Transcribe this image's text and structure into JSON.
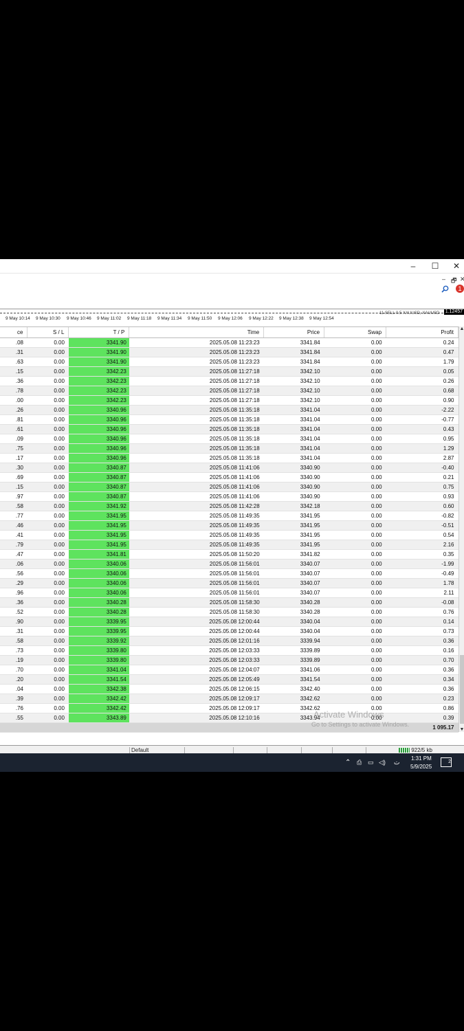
{
  "window": {
    "min_glyph": "–",
    "max_glyph": "☐",
    "close_glyph": "✕"
  },
  "mdi": {
    "min_glyph": "–",
    "restore_glyph": "🗗",
    "close_glyph": "✕"
  },
  "notification_count": "1",
  "chart": {
    "price_tag": "1.12457",
    "truncated_label": "11.SELL 0.5 XAUUSD, XAUUSD",
    "time_labels": [
      "9 May 10:14",
      "9 May 10:30",
      "9 May 10:46",
      "9 May 11:02",
      "9 May 11:18",
      "9 May 11:34",
      "9 May 11:50",
      "9 May 12:06",
      "9 May 12:22",
      "9 May 12:38",
      "9 May 12:54"
    ]
  },
  "table": {
    "columns": [
      "ce",
      "S / L",
      "T / P",
      "Time",
      "Price",
      "Swap",
      "Profit"
    ],
    "rows": [
      [
        ".08",
        "0.00",
        "3341.90",
        "2025.05.08 11:23:23",
        "3341.84",
        "0.00",
        "0.24"
      ],
      [
        ".31",
        "0.00",
        "3341.90",
        "2025.05.08 11:23:23",
        "3341.84",
        "0.00",
        "0.47"
      ],
      [
        ".63",
        "0.00",
        "3341.90",
        "2025.05.08 11:23:23",
        "3341.84",
        "0.00",
        "1.79"
      ],
      [
        ".15",
        "0.00",
        "3342.23",
        "2025.05.08 11:27:18",
        "3342.10",
        "0.00",
        "0.05"
      ],
      [
        ".36",
        "0.00",
        "3342.23",
        "2025.05.08 11:27:18",
        "3342.10",
        "0.00",
        "0.26"
      ],
      [
        ".78",
        "0.00",
        "3342.23",
        "2025.05.08 11:27:18",
        "3342.10",
        "0.00",
        "0.68"
      ],
      [
        ".00",
        "0.00",
        "3342.23",
        "2025.05.08 11:27:18",
        "3342.10",
        "0.00",
        "0.90"
      ],
      [
        ".26",
        "0.00",
        "3340.96",
        "2025.05.08 11:35:18",
        "3341.04",
        "0.00",
        "-2.22"
      ],
      [
        ".81",
        "0.00",
        "3340.96",
        "2025.05.08 11:35:18",
        "3341.04",
        "0.00",
        "-0.77"
      ],
      [
        ".61",
        "0.00",
        "3340.96",
        "2025.05.08 11:35:18",
        "3341.04",
        "0.00",
        "0.43"
      ],
      [
        ".09",
        "0.00",
        "3340.96",
        "2025.05.08 11:35:18",
        "3341.04",
        "0.00",
        "0.95"
      ],
      [
        ".75",
        "0.00",
        "3340.96",
        "2025.05.08 11:35:18",
        "3341.04",
        "0.00",
        "1.29"
      ],
      [
        ".17",
        "0.00",
        "3340.96",
        "2025.05.08 11:35:18",
        "3341.04",
        "0.00",
        "2.87"
      ],
      [
        ".30",
        "0.00",
        "3340.87",
        "2025.05.08 11:41:06",
        "3340.90",
        "0.00",
        "-0.40"
      ],
      [
        ".69",
        "0.00",
        "3340.87",
        "2025.05.08 11:41:06",
        "3340.90",
        "0.00",
        "0.21"
      ],
      [
        ".15",
        "0.00",
        "3340.87",
        "2025.05.08 11:41:06",
        "3340.90",
        "0.00",
        "0.75"
      ],
      [
        ".97",
        "0.00",
        "3340.87",
        "2025.05.08 11:41:06",
        "3340.90",
        "0.00",
        "0.93"
      ],
      [
        ".58",
        "0.00",
        "3341.92",
        "2025.05.08 11:42:28",
        "3342.18",
        "0.00",
        "0.60"
      ],
      [
        ".77",
        "0.00",
        "3341.95",
        "2025.05.08 11:49:35",
        "3341.95",
        "0.00",
        "-0.82"
      ],
      [
        ".46",
        "0.00",
        "3341.95",
        "2025.05.08 11:49:35",
        "3341.95",
        "0.00",
        "-0.51"
      ],
      [
        ".41",
        "0.00",
        "3341.95",
        "2025.05.08 11:49:35",
        "3341.95",
        "0.00",
        "0.54"
      ],
      [
        ".79",
        "0.00",
        "3341.95",
        "2025.05.08 11:49:35",
        "3341.95",
        "0.00",
        "2.16"
      ],
      [
        ".47",
        "0.00",
        "3341.81",
        "2025.05.08 11:50:20",
        "3341.82",
        "0.00",
        "0.35"
      ],
      [
        ".06",
        "0.00",
        "3340.06",
        "2025.05.08 11:56:01",
        "3340.07",
        "0.00",
        "-1.99"
      ],
      [
        ".56",
        "0.00",
        "3340.06",
        "2025.05.08 11:56:01",
        "3340.07",
        "0.00",
        "-0.49"
      ],
      [
        ".29",
        "0.00",
        "3340.06",
        "2025.05.08 11:56:01",
        "3340.07",
        "0.00",
        "1.78"
      ],
      [
        ".96",
        "0.00",
        "3340.06",
        "2025.05.08 11:56:01",
        "3340.07",
        "0.00",
        "2.11"
      ],
      [
        ".36",
        "0.00",
        "3340.28",
        "2025.05.08 11:58:30",
        "3340.28",
        "0.00",
        "-0.08"
      ],
      [
        ".52",
        "0.00",
        "3340.28",
        "2025.05.08 11:58:30",
        "3340.28",
        "0.00",
        "0.76"
      ],
      [
        ".90",
        "0.00",
        "3339.95",
        "2025.05.08 12:00:44",
        "3340.04",
        "0.00",
        "0.14"
      ],
      [
        ".31",
        "0.00",
        "3339.95",
        "2025.05.08 12:00:44",
        "3340.04",
        "0.00",
        "0.73"
      ],
      [
        ".58",
        "0.00",
        "3339.92",
        "2025.05.08 12:01:16",
        "3339.94",
        "0.00",
        "0.36"
      ],
      [
        ".73",
        "0.00",
        "3339.80",
        "2025.05.08 12:03:33",
        "3339.89",
        "0.00",
        "0.16"
      ],
      [
        ".19",
        "0.00",
        "3339.80",
        "2025.05.08 12:03:33",
        "3339.89",
        "0.00",
        "0.70"
      ],
      [
        ".70",
        "0.00",
        "3341.04",
        "2025.05.08 12:04:07",
        "3341.06",
        "0.00",
        "0.36"
      ],
      [
        ".20",
        "0.00",
        "3341.54",
        "2025.05.08 12:05:49",
        "3341.54",
        "0.00",
        "0.34"
      ],
      [
        ".04",
        "0.00",
        "3342.38",
        "2025.05.08 12:06:15",
        "3342.40",
        "0.00",
        "0.36"
      ],
      [
        ".39",
        "0.00",
        "3342.42",
        "2025.05.08 12:09:17",
        "3342.62",
        "0.00",
        "0.23"
      ],
      [
        ".76",
        "0.00",
        "3342.42",
        "2025.05.08 12:09:17",
        "3342.62",
        "0.00",
        "0.86"
      ],
      [
        ".55",
        "0.00",
        "3343.89",
        "2025.05.08 12:10:16",
        "3343.94",
        "0.00",
        "0.39"
      ]
    ],
    "total_profit": "1 095.17"
  },
  "watermark": {
    "line1": "Activate Windows",
    "line2": "Go to Settings to activate Windows."
  },
  "statusbar": {
    "profile": "Default",
    "connection": "922/5 kb"
  },
  "taskbar": {
    "time": "1:31 PM",
    "date": "5/9/2025",
    "tray_text": "ت",
    "notif_count": "2"
  },
  "colors": {
    "tp_highlight": "#5ee35e",
    "taskbar": "#1b2330"
  }
}
